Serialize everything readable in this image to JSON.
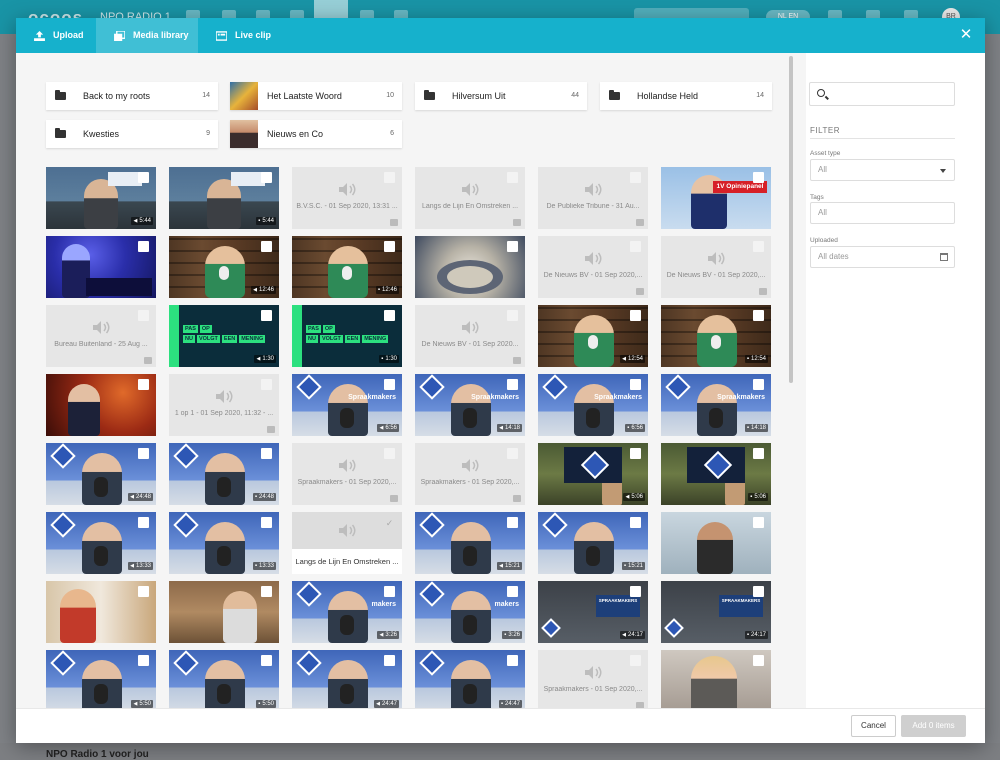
{
  "background_app": {
    "logo": "ocoos",
    "channel": "NPO RADIO 1",
    "lang_label": "NL EN",
    "avatar_initials": "BR",
    "footer_text": "NPO Radio 1 voor jou"
  },
  "modal": {
    "tabs": [
      {
        "label": "Upload",
        "icon": "upload-icon"
      },
      {
        "label": "Media library",
        "icon": "media-library-icon"
      },
      {
        "label": "Live clip",
        "icon": "live-clip-icon"
      }
    ],
    "active_tab": "Media library",
    "close_icon": "close-icon"
  },
  "folders": [
    {
      "name": "Back to my roots",
      "count": "14",
      "thumb": false
    },
    {
      "name": "Het Laatste Woord",
      "count": "10",
      "thumb": true
    },
    {
      "name": "Hilversum Uit",
      "count": "44",
      "thumb": false
    },
    {
      "name": "Hollandse Held",
      "count": "14",
      "thumb": false
    },
    {
      "name": "Kwesties",
      "count": "9",
      "thumb": false
    },
    {
      "name": "Nieuws en Co",
      "count": "6",
      "thumb": true
    }
  ],
  "tiles": [
    {
      "kind": "video",
      "scene": "studio",
      "duration": "5:44",
      "audio": true
    },
    {
      "kind": "video",
      "scene": "studio",
      "duration": "5:44",
      "audio": false
    },
    {
      "kind": "audio",
      "title": "B.V.S.C. - 01 Sep 2020, 13:31 ..."
    },
    {
      "kind": "audio",
      "title": "Langs de Lijn En Omstreken ..."
    },
    {
      "kind": "audio",
      "title": "De Publieke Tribune - 31 Au..."
    },
    {
      "kind": "video",
      "scene": "opinie",
      "tag": "1V Opiniepanel"
    },
    {
      "kind": "video",
      "scene": "dj"
    },
    {
      "kind": "video",
      "scene": "library",
      "duration": "12:46",
      "audio": true
    },
    {
      "kind": "video",
      "scene": "library",
      "duration": "12:46",
      "audio": false
    },
    {
      "kind": "video",
      "scene": "food"
    },
    {
      "kind": "audio",
      "title": "De Nieuws BV - 01 Sep 2020,..."
    },
    {
      "kind": "audio",
      "title": "De Nieuws BV - 01 Sep 2020,..."
    },
    {
      "kind": "audio",
      "title": "Bureau Buitenland - 25 Aug ..."
    },
    {
      "kind": "video",
      "scene": "pas",
      "duration": "1:30",
      "audio": true
    },
    {
      "kind": "video",
      "scene": "pas",
      "duration": "1:30",
      "audio": false
    },
    {
      "kind": "audio",
      "title": "De Nieuws BV - 01 Sep 2020..."
    },
    {
      "kind": "video",
      "scene": "library",
      "duration": "12:54",
      "audio": true
    },
    {
      "kind": "video",
      "scene": "library",
      "duration": "12:54",
      "audio": false
    },
    {
      "kind": "video",
      "scene": "red"
    },
    {
      "kind": "audio",
      "title": "1 op 1 - 01 Sep 2020, 11:32 - ..."
    },
    {
      "kind": "video",
      "scene": "npo",
      "word": "Spraakmakers",
      "duration": "6:56",
      "audio": true
    },
    {
      "kind": "video",
      "scene": "npo",
      "word": "Spraakmakers",
      "duration": "14:18",
      "audio": true
    },
    {
      "kind": "video",
      "scene": "npo",
      "word": "Spraakmakers",
      "duration": "6:56",
      "audio": false
    },
    {
      "kind": "video",
      "scene": "npo",
      "word": "Spraakmakers",
      "duration": "14:18",
      "audio": false
    },
    {
      "kind": "video",
      "scene": "npo",
      "word": "",
      "duration": "24:48",
      "audio": true
    },
    {
      "kind": "video",
      "scene": "npo",
      "word": "",
      "duration": "24:48",
      "audio": false
    },
    {
      "kind": "audio",
      "title": "Spraakmakers - 01 Sep 2020,..."
    },
    {
      "kind": "audio",
      "title": "Spraakmakers - 01 Sep 2020,..."
    },
    {
      "kind": "video",
      "scene": "tv",
      "duration": "5:06",
      "audio": true
    },
    {
      "kind": "video",
      "scene": "tv",
      "duration": "5:06",
      "audio": false
    },
    {
      "kind": "video",
      "scene": "npo",
      "word": "",
      "duration": "13:33",
      "audio": true
    },
    {
      "kind": "video",
      "scene": "npo",
      "word": "",
      "duration": "13:33",
      "audio": false
    },
    {
      "kind": "hover",
      "title": "Langs de Lijn En Omstreken ..."
    },
    {
      "kind": "video",
      "scene": "npo",
      "word": "",
      "duration": "15:21",
      "audio": true
    },
    {
      "kind": "video",
      "scene": "npo",
      "word": "",
      "duration": "15:21",
      "audio": false
    },
    {
      "kind": "video",
      "scene": "portrait"
    },
    {
      "kind": "video",
      "scene": "woman"
    },
    {
      "kind": "video",
      "scene": "office"
    },
    {
      "kind": "video",
      "scene": "npo",
      "word": "makers",
      "duration": "3:26",
      "audio": true
    },
    {
      "kind": "video",
      "scene": "npo",
      "word": "makers",
      "duration": "3:26",
      "audio": false
    },
    {
      "kind": "video",
      "scene": "spraak",
      "banner": "SPRAAKMAKERS",
      "duration": "24:17",
      "audio": true
    },
    {
      "kind": "video",
      "scene": "spraak",
      "banner": "SPRAAKMAKERS",
      "duration": "24:17",
      "audio": false
    },
    {
      "kind": "video",
      "scene": "npo",
      "word": "",
      "duration": "5:50",
      "audio": true
    },
    {
      "kind": "video",
      "scene": "npo",
      "word": "",
      "duration": "5:50",
      "audio": false
    },
    {
      "kind": "video",
      "scene": "npo",
      "word": "",
      "duration": "24:47",
      "audio": true
    },
    {
      "kind": "video",
      "scene": "npo",
      "word": "",
      "duration": "24:47",
      "audio": false
    },
    {
      "kind": "audio",
      "title": "Spraakmakers - 01 Sep 2020,..."
    },
    {
      "kind": "video",
      "scene": "blonde"
    }
  ],
  "filter": {
    "search_placeholder": "",
    "heading": "FILTER",
    "asset_type_label": "Asset type",
    "asset_type_value": "All",
    "tags_label": "Tags",
    "tags_placeholder": "All",
    "uploaded_label": "Uploaded",
    "uploaded_placeholder": "All dates"
  },
  "footer": {
    "cancel_label": "Cancel",
    "add_label": "Add 0 items"
  },
  "colors": {
    "header": "#16b1cc",
    "topbar": "#1994a6"
  }
}
